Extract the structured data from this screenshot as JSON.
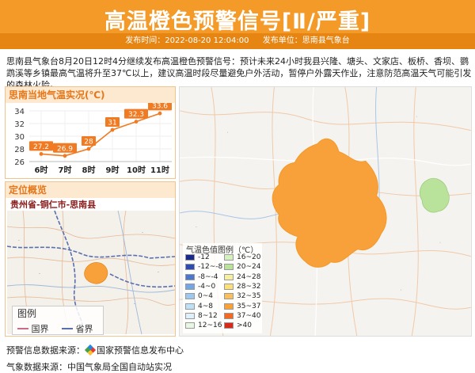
{
  "header": {
    "title": "高温橙色预警信号[Ⅱ/严重]",
    "publish_time": "发布时间：2022-08-20 12:04:00",
    "publisher": "发布单位：思南县气象台"
  },
  "body_text": "思南县气象台8月20日12时4分继续发布高温橙色预警信号：预计未来24小时我县兴隆、塘头、文家店、板桥、香坝、鹦鹉溪等乡镇最高气温将升至37℃以上，建议高温时段尽量避免户外活动，暂停户外露天作业，注意防范高温天气可能引发的森林火险。",
  "chart_panel": {
    "title": "思南当地气温实况(℃)"
  },
  "chart_data": {
    "type": "line",
    "title": "思南当地气温实况(℃)",
    "categories": [
      "6时",
      "7时",
      "8时",
      "9时",
      "10时",
      "11时"
    ],
    "values": [
      27.2,
      26.9,
      28,
      31,
      32.3,
      33.6
    ],
    "labels": [
      "27.2",
      "26.9",
      "28",
      "31",
      "32.3",
      "33.6"
    ],
    "y_ticks": [
      "34",
      "32",
      "30",
      "28",
      "26"
    ],
    "ylim": [
      26,
      34
    ],
    "grid": true,
    "color": "#f07b22"
  },
  "location": {
    "title": "定位概览",
    "name": "贵州省-铜仁市-思南县",
    "legend_title": "图例",
    "legend_items": [
      {
        "label": "国界",
        "color": "#c96b8a"
      },
      {
        "label": "省界",
        "color": "#5a6fb0"
      }
    ]
  },
  "scale": {
    "title": "气温色值图例（℃）",
    "left": [
      {
        "label": "-12",
        "color": "#1a2a8a"
      },
      {
        "label": "-12~-8",
        "color": "#2d4bb0"
      },
      {
        "label": "-8~-4",
        "color": "#4a78d0"
      },
      {
        "label": "-4~0",
        "color": "#73a5e8"
      },
      {
        "label": "0~4",
        "color": "#9dc8f0"
      },
      {
        "label": "4~8",
        "color": "#bfe0f5"
      },
      {
        "label": "8~12",
        "color": "#dff0fa"
      },
      {
        "label": "12~16",
        "color": "#e9f6e1"
      }
    ],
    "right": [
      {
        "label": "16~20",
        "color": "#d7f0c0"
      },
      {
        "label": "20~24",
        "color": "#b9e39a"
      },
      {
        "label": "24~28",
        "color": "#f5f0a0"
      },
      {
        "label": "28~32",
        "color": "#fbe07a"
      },
      {
        "label": "32~35",
        "color": "#fbbf5a"
      },
      {
        "label": "35~37",
        "color": "#f8a039"
      },
      {
        "label": "37~40",
        "color": "#f06a24"
      },
      {
        "label": ">40",
        "color": "#d62a1a"
      }
    ]
  },
  "footer": {
    "line1_prefix": "预警信息数据来源：",
    "line1_source": "国家预警信息发布中心",
    "line2": "气象数据来源：中国气象局全国自动站实况"
  }
}
